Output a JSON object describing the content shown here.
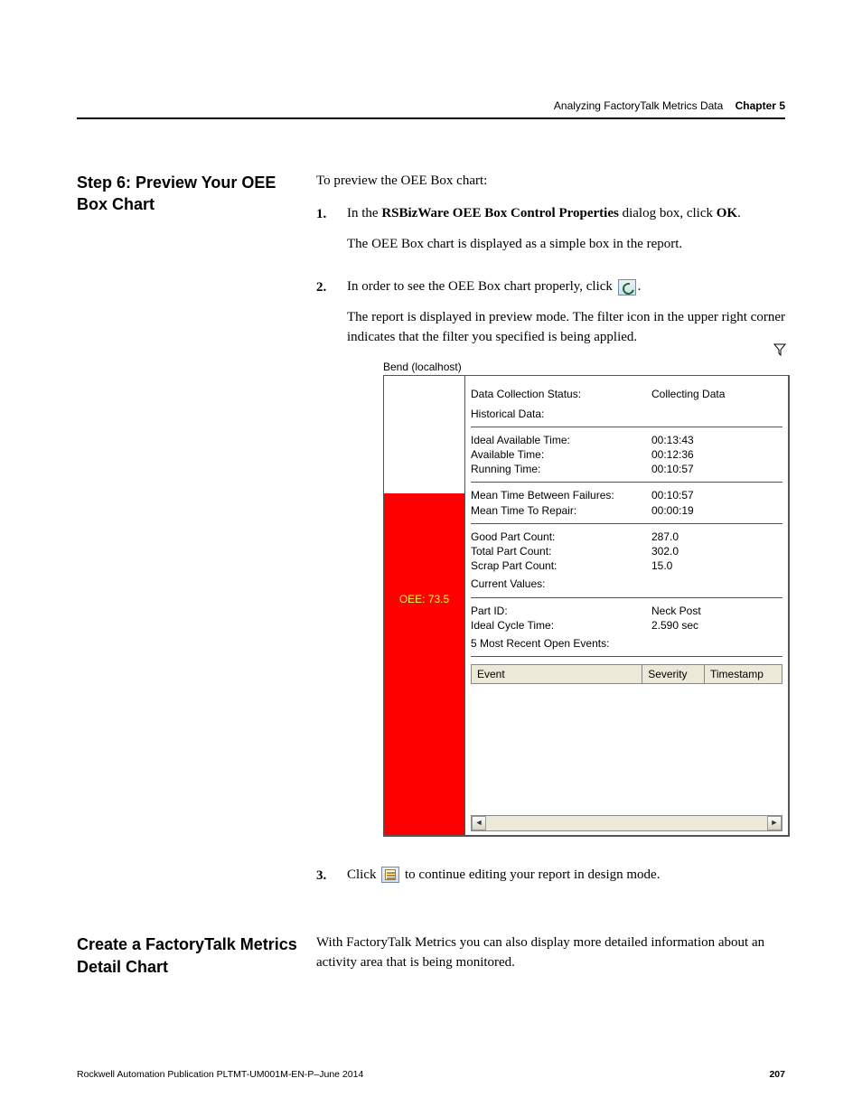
{
  "header": {
    "breadcrumb": "Analyzing FactoryTalk Metrics Data",
    "chapter_label": "Chapter 5"
  },
  "section1": {
    "sidehead": "Step 6: Preview Your OEE Box Chart",
    "intro": "To preview the OEE Box chart:",
    "step1_a": "In the ",
    "step1_b": "RSBizWare OEE Box Control Properties",
    "step1_c": " dialog box, click ",
    "step1_d": "OK",
    "step1_e": ".",
    "step1_after": "The OEE Box chart is displayed as a simple box in the report.",
    "step2_a": "In order to see the OEE Box chart properly, click ",
    "step2_after": "The report is displayed in preview mode. The filter icon in the upper right corner indicates that the filter you specified is being applied.",
    "step3_a": "Click ",
    "step3_b": " to continue editing your report in design mode."
  },
  "oee": {
    "title": "Bend (localhost)",
    "gauge_label": "OEE: 73.5",
    "dcs_label": "Data Collection Status:",
    "dcs_value": "Collecting Data",
    "hist_label": "Historical Data:",
    "ideal_label": "Ideal Available Time:",
    "ideal_value": "00:13:43",
    "avail_label": "Available Time:",
    "avail_value": "00:12:36",
    "run_label": "Running Time:",
    "run_value": "00:10:57",
    "mtbf_label": "Mean Time Between Failures:",
    "mtbf_value": "00:10:57",
    "mttr_label": "Mean Time To Repair:",
    "mttr_value": "00:00:19",
    "good_label": "Good Part Count:",
    "good_value": "287.0",
    "total_label": "Total Part Count:",
    "total_value": "302.0",
    "scrap_label": "Scrap Part Count:",
    "scrap_value": "15.0",
    "current_label": "Current Values:",
    "partid_label": "Part ID:",
    "partid_value": "Neck Post",
    "ict_label": "Ideal Cycle Time:",
    "ict_value": "2.590 sec",
    "events_label": "5 Most Recent Open Events:",
    "col_event": "Event",
    "col_severity": "Severity",
    "col_timestamp": "Timestamp"
  },
  "section2": {
    "sidehead": "Create a FactoryTalk Metrics Detail Chart",
    "body": "With FactoryTalk Metrics you can also display more detailed information about an activity area that is being monitored."
  },
  "footer": {
    "pub": "Rockwell Automation Publication PLTMT-UM001M-EN-P–June 2014",
    "page": "207"
  }
}
